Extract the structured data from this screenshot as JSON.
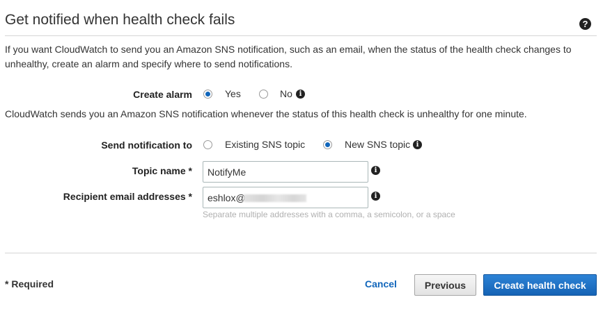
{
  "section": {
    "title": "Get notified when health check fails",
    "intro": "If you want CloudWatch to send you an Amazon SNS notification, such as an email, when the status of the health check changes to unhealthy, create an alarm and specify where to send notifications."
  },
  "create_alarm": {
    "label": "Create alarm",
    "options": [
      "Yes",
      "No"
    ],
    "selected": "Yes"
  },
  "note": "CloudWatch sends you an Amazon SNS notification whenever the status of this health check is unhealthy for one minute.",
  "send_notification": {
    "label": "Send notification to",
    "options": [
      "Existing SNS topic",
      "New SNS topic"
    ],
    "selected": "New SNS topic"
  },
  "topic_name": {
    "label": "Topic name *",
    "value": "NotifyMe"
  },
  "recipient_emails": {
    "label": "Recipient email addresses *",
    "value": "eshlox@",
    "hint": "Separate multiple addresses with a comma, a semicolon, or a space"
  },
  "footer": {
    "required": "* Required",
    "cancel": "Cancel",
    "previous": "Previous",
    "create": "Create health check"
  },
  "colors": {
    "accent": "#1166bb",
    "primary_button": "#1a6fc5"
  },
  "icons": {
    "help": "question-circle-icon",
    "info": "info-circle-icon"
  }
}
